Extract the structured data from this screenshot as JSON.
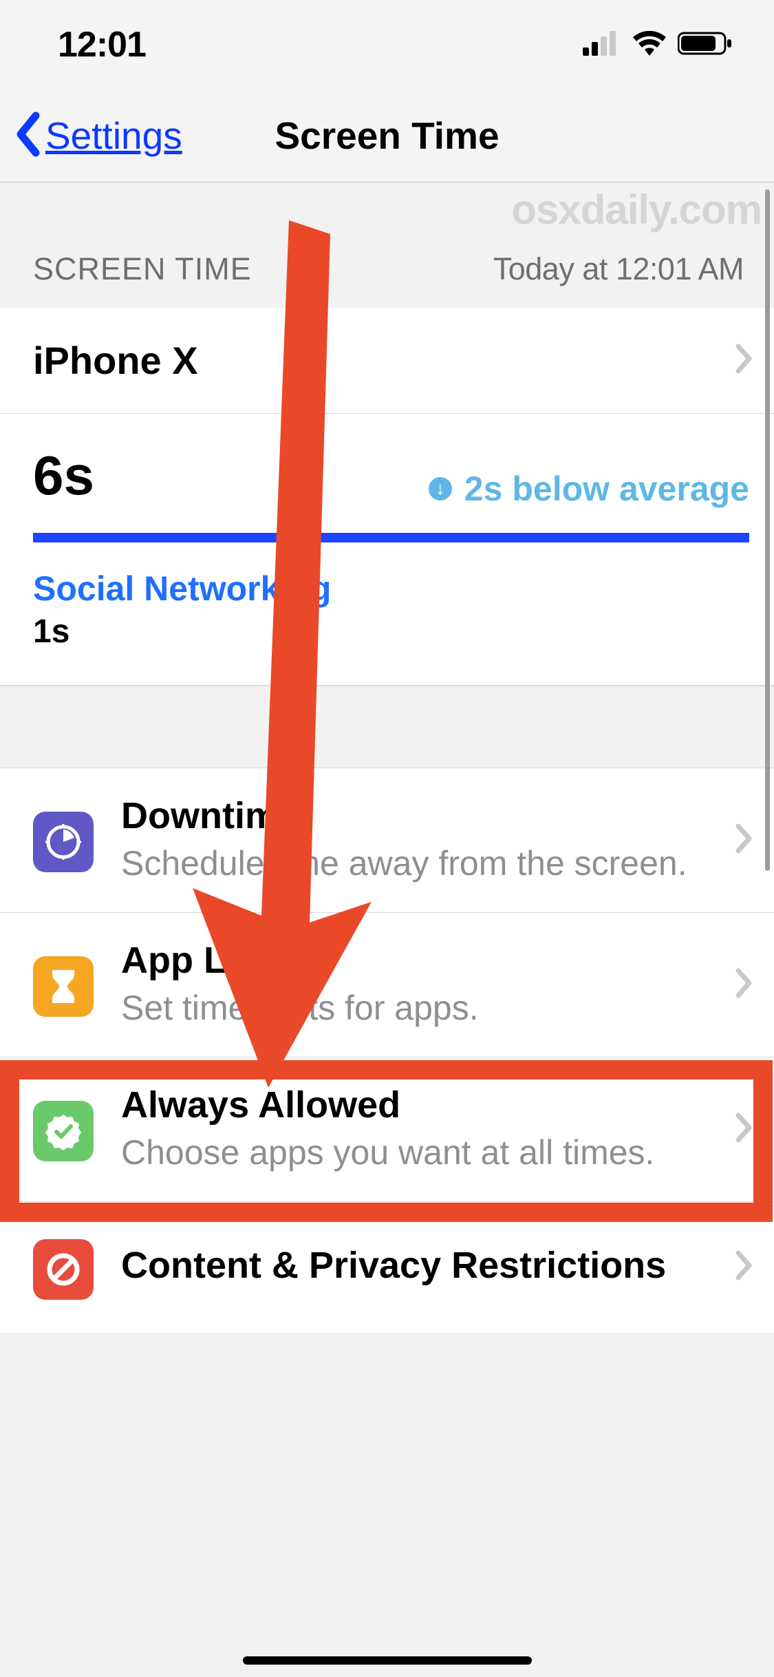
{
  "status": {
    "time": "12:01"
  },
  "nav": {
    "back_label": "Settings",
    "title": "Screen Time"
  },
  "watermark": "osxdaily.com",
  "section": {
    "left_label": "SCREEN TIME",
    "right_label": "Today at 12:01 AM"
  },
  "device": {
    "name": "iPhone X"
  },
  "usage": {
    "total": "6s",
    "compare_text": "2s below average",
    "category_name": "Social Networking",
    "category_time": "1s"
  },
  "menu": {
    "downtime": {
      "title": "Downtime",
      "subtitle": "Schedule time away from the screen."
    },
    "app_limits": {
      "title": "App Limits",
      "subtitle": "Set time limits for apps."
    },
    "always_allowed": {
      "title": "Always Allowed",
      "subtitle": "Choose apps you want at all times."
    },
    "content_privacy": {
      "title": "Content & Privacy Restrictions"
    }
  }
}
